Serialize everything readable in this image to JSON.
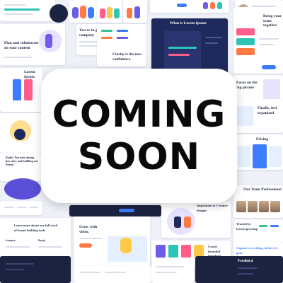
{
  "overlay": {
    "line1": "COMING",
    "line2": "SOON"
  },
  "background": {
    "tiles": {
      "plan": "Plan and collaborate on your content",
      "good_company": "You're in good company",
      "clarity": "Clarity is the new confidence.",
      "lorem_top": "What is Lorem Ipsum",
      "lorem_left": "Lorem Ipsum",
      "bring_team": "Bring your team together",
      "finally": "Finally, feel organized",
      "pricing": "Pricing",
      "team": "Our Team Professional",
      "grow": "Grow with video.",
      "learn": "Learn more about our full stack of brand building tools",
      "analyze": "Analyze",
      "reply": "Reply",
      "capture": "Capture everything, before it's gone",
      "feedbird": "Feedbird",
      "trusted": "Trusted by Lorem growing",
      "inspiration": "Inspiration to Creative designs",
      "article": "Article Name",
      "radio": "Radio: You took during day story and building our Brand",
      "templates": "Create beautiful templates",
      "focus": "Focus on the big picture"
    }
  }
}
